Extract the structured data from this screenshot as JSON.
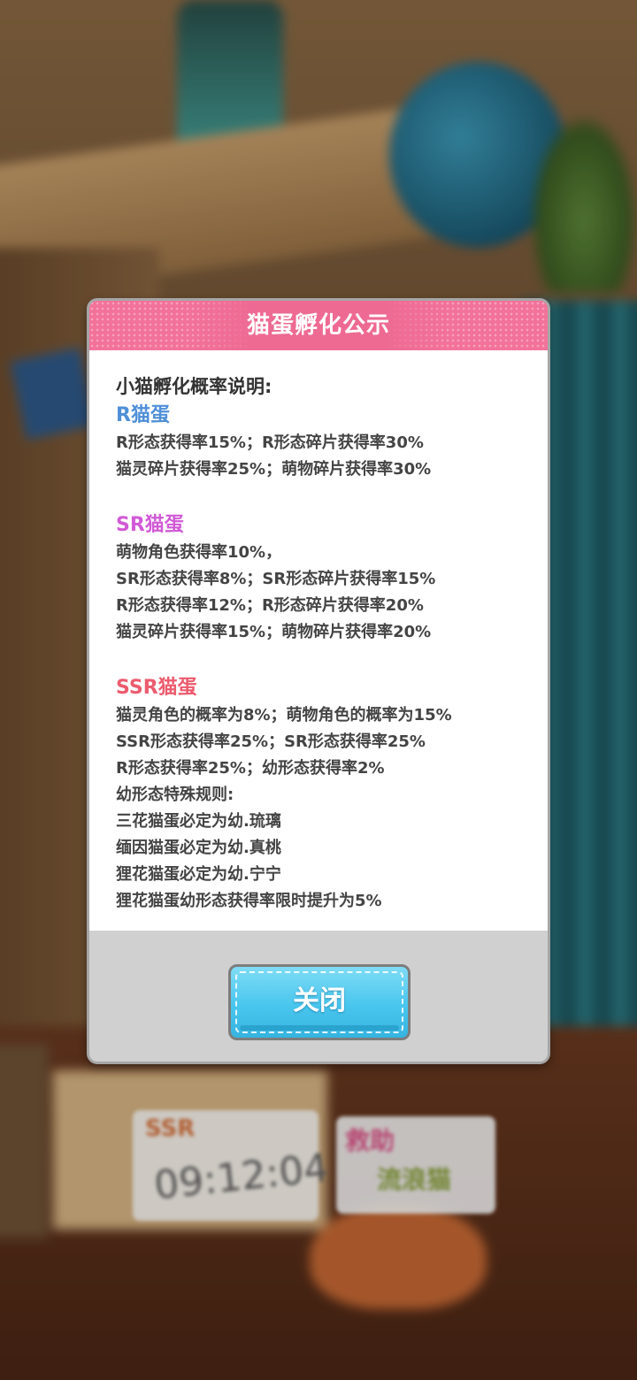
{
  "background": {
    "timer_badge": "SSR",
    "timer": "09:12:04",
    "help_title": "救助",
    "help_subtitle": "流浪猫"
  },
  "modal": {
    "title": "猫蛋孵化公示",
    "intro": "小猫孵化概率说明:",
    "sections": [
      {
        "title": "R猫蛋",
        "color": "#4f8fd8",
        "lines": [
          "R形态获得率15%；R形态碎片获得率30%",
          "猫灵碎片获得率25%；萌物碎片获得率30%"
        ]
      },
      {
        "title": "SR猫蛋",
        "color": "#d15ad6",
        "lines": [
          "萌物角色获得率10%，",
          "SR形态获得率8%；SR形态碎片获得率15%",
          "R形态获得率12%；R形态碎片获得率20%",
          "猫灵碎片获得率15%；萌物碎片获得率20%"
        ]
      },
      {
        "title": "SSR猫蛋",
        "color": "#ec5b6e",
        "lines": [
          "猫灵角色的概率为8%；萌物角色的概率为15%",
          "SSR形态获得率25%；SR形态获得率25%",
          "R形态获得率25%；幼形态获得率2%",
          "幼形态特殊规则:",
          "三花猫蛋必定为幼.琉璃",
          "缅因猫蛋必定为幼.真桃",
          "狸花猫蛋必定为幼.宁宁",
          "狸花猫蛋幼形态获得率限时提升为5%"
        ]
      }
    ],
    "close_label": "关闭"
  },
  "colors": {
    "header_pink": "#f2729a",
    "button_blue": "#49c6ee",
    "panel_grey": "#d0d0d0"
  }
}
